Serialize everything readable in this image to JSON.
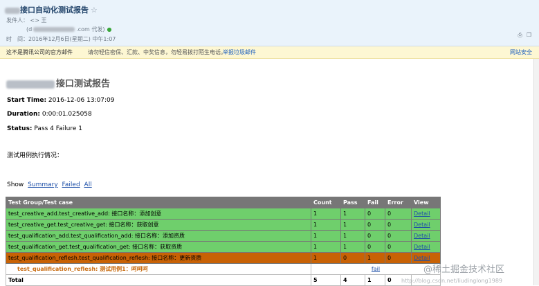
{
  "mail": {
    "subject": "接口自动化测试报告",
    "star": "☆",
    "from_label": "发件人：",
    "from_name": "<>",
    "from_name_tail": "王",
    "from_addr_prefix": "(d",
    "from_addr_suffix": ".com 代发)",
    "time_label": "时　间：",
    "time_value": "2016年12月6日(星期二) 中午1:07"
  },
  "warning": {
    "text1": "这不是腾讯公司的官方邮件",
    "text2": "请勿轻信密保、汇款、中奖信息，勿轻易拨打陌生电话。",
    "report_link": "举报垃圾邮件",
    "right_text": "网站安全"
  },
  "report": {
    "title": "接口测试报告",
    "start_label": "Start Time:",
    "start_value": "2016-12-06 13:07:09",
    "duration_label": "Duration:",
    "duration_value": "0:00:01.025058",
    "status_label": "Status:",
    "status_value": "Pass 4 Failure 1",
    "description": "测试用例执行情况：",
    "show_label": "Show",
    "show_links": [
      "Summary",
      "Failed",
      "All"
    ]
  },
  "table": {
    "headers": [
      "Test Group/Test case",
      "Count",
      "Pass",
      "Fail",
      "Error",
      "View"
    ],
    "rows": [
      {
        "name": "test_creative_add.test_creative_add: 接口名称：添加创意",
        "count": "1",
        "pass": "1",
        "fail": "0",
        "error": "0",
        "view": "Detail"
      },
      {
        "name": "test_creative_get.test_creative_get: 接口名称：获取创意",
        "count": "1",
        "pass": "1",
        "fail": "0",
        "error": "0",
        "view": "Detail"
      },
      {
        "name": "test_qualification_add.test_qualification_add: 接口名称：添加资质",
        "count": "1",
        "pass": "1",
        "fail": "0",
        "error": "0",
        "view": "Detail"
      },
      {
        "name": "test_qualification_get.test_qualification_get: 接口名称：获取资质",
        "count": "1",
        "pass": "1",
        "fail": "0",
        "error": "0",
        "view": "Detail"
      },
      {
        "name": "test_qualification_reflesh.test_qualification_reflesh: 接口名称：更新资质",
        "count": "1",
        "pass": "0",
        "fail": "1",
        "error": "0",
        "view": "Detail"
      }
    ],
    "detail_row": {
      "name": "test_qualification_reflesh: 测试用例1：呵呵呵",
      "result": "fail"
    },
    "total": {
      "label": "Total",
      "count": "5",
      "pass": "4",
      "fail": "1",
      "error": "0"
    }
  },
  "watermark": {
    "main": "@稀土掘金技术社区",
    "sub": "http://blog.csdn.net/liudinglong1989"
  },
  "colors": {
    "pass_row": "#6fcf6c",
    "fail_row": "#c86205",
    "header_row": "#777777"
  }
}
